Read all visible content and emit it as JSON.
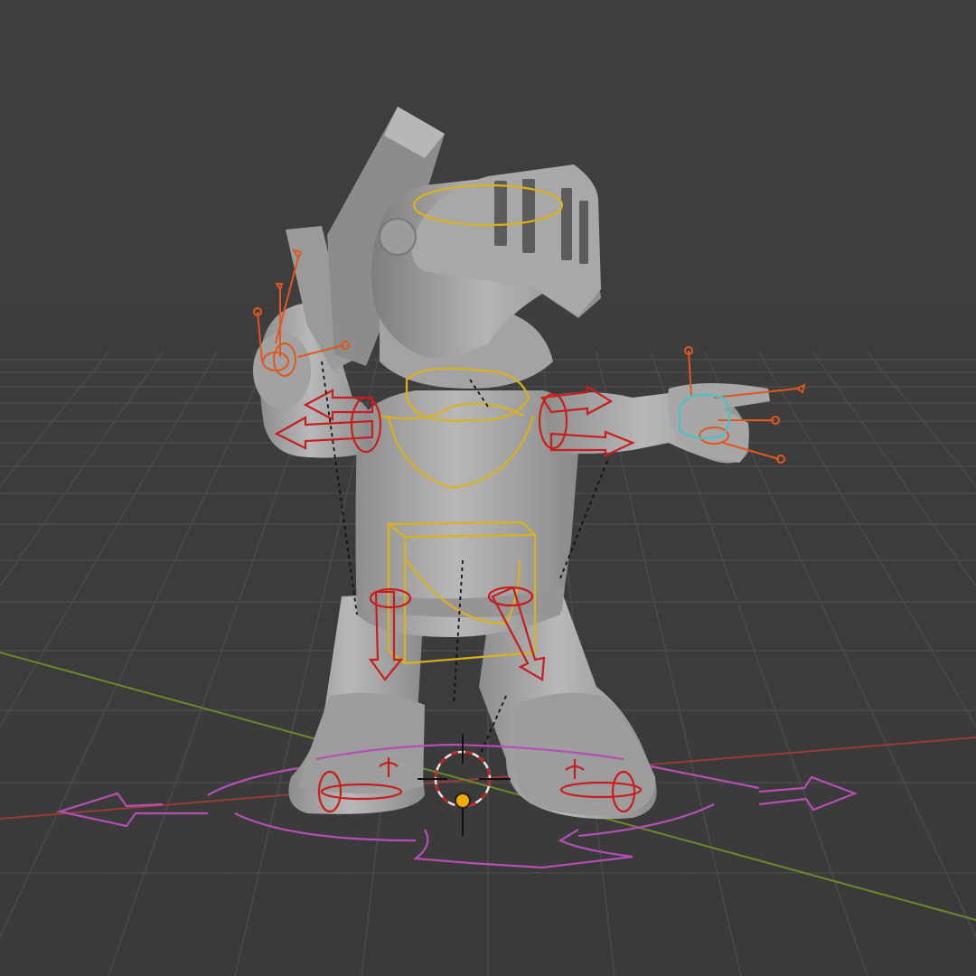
{
  "viewport": {
    "editor": "3D Viewport",
    "shading": "solid",
    "view": "perspective"
  },
  "scene": {
    "character": "chibi-knight-with-sword",
    "rig_controls": [
      "head-control",
      "neck-control",
      "chest-control",
      "hip-control",
      "shoulder-controls",
      "hand-ik-controls",
      "finger-controls",
      "leg-controls",
      "foot-roll-controls",
      "root-control"
    ],
    "visible_objects": [
      "floor-grid",
      "x-axis-line",
      "y-axis-line",
      "3d-cursor",
      "origin-point"
    ]
  },
  "colors": {
    "background": "#3d3d3d",
    "grid": "#4a4a4a",
    "mesh": "#a5a5a5",
    "x_axis": "#9a3b3b",
    "y_axis": "#6a8a2a",
    "control_red": "#c81e1e",
    "control_yellow": "#d9b21c",
    "control_orange": "#e0581f",
    "control_cyan": "#4ec0c8",
    "control_magenta": "#b54fb3",
    "cursor": "#e8e8e8",
    "origin": "#f2a900"
  }
}
